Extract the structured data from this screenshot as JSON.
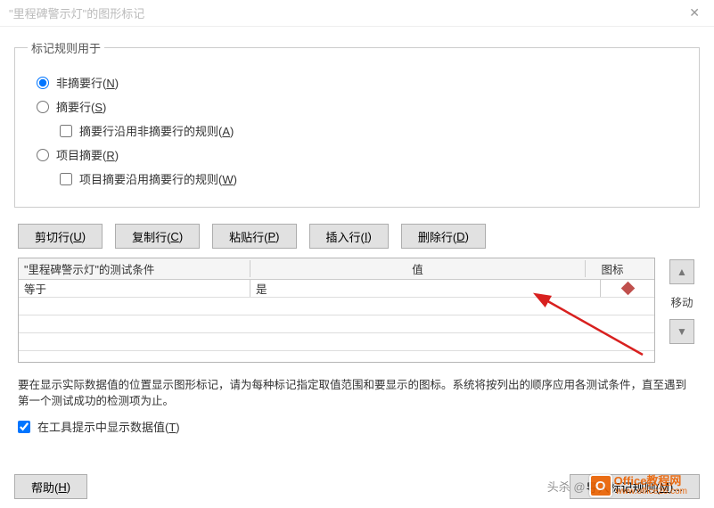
{
  "title": "\"里程碑警示灯\"的图形标记",
  "fieldset": {
    "legend": "标记规则用于",
    "opt_non_summary": "非摘要行(",
    "opt_non_summary_k": "N",
    "opt_non_summary_e": ")",
    "opt_summary": "摘要行(",
    "opt_summary_k": "S",
    "opt_summary_e": ")",
    "chk_summary_inherit": "摘要行沿用非摘要行的规则(",
    "chk_summary_inherit_k": "A",
    "chk_summary_inherit_e": ")",
    "opt_proj": "项目摘要(",
    "opt_proj_k": "R",
    "opt_proj_e": ")",
    "chk_proj_inherit": "项目摘要沿用摘要行的规则(",
    "chk_proj_inherit_k": "W",
    "chk_proj_inherit_e": ")"
  },
  "buttons": {
    "cut": "剪切行(",
    "cut_k": "U",
    "cut_e": ")",
    "copy": "复制行(",
    "copy_k": "C",
    "copy_e": ")",
    "paste": "粘贴行(",
    "paste_k": "P",
    "paste_e": ")",
    "insert": "插入行(",
    "insert_k": "I",
    "insert_e": ")",
    "delete": "删除行(",
    "delete_k": "D",
    "delete_e": ")"
  },
  "table": {
    "col1": "\"里程碑警示灯\"的测试条件",
    "col2": "值",
    "col3": "图标",
    "rows": [
      {
        "cond": "等于",
        "val": "是",
        "icon": "diamond-red"
      }
    ]
  },
  "move_label": "移动",
  "hint": "要在显示实际数据值的位置显示图形标记，请为每种标记指定取值范围和要显示的图标。系统将按列出的顺序应用各测试条件，直至遇到第一个测试成功的检测项为止。",
  "show_tooltip": "在工具提示中显示数据值(",
  "show_tooltip_k": "T",
  "show_tooltip_e": ")",
  "footer": {
    "help": "帮助(",
    "help_k": "H",
    "help_e": ")",
    "import": "导入标记规则(",
    "import_k": "M",
    "import_e": ")..."
  },
  "watermark": {
    "a": "头杀 @",
    "b": "Office教程网",
    "c": "www.office26.com"
  }
}
